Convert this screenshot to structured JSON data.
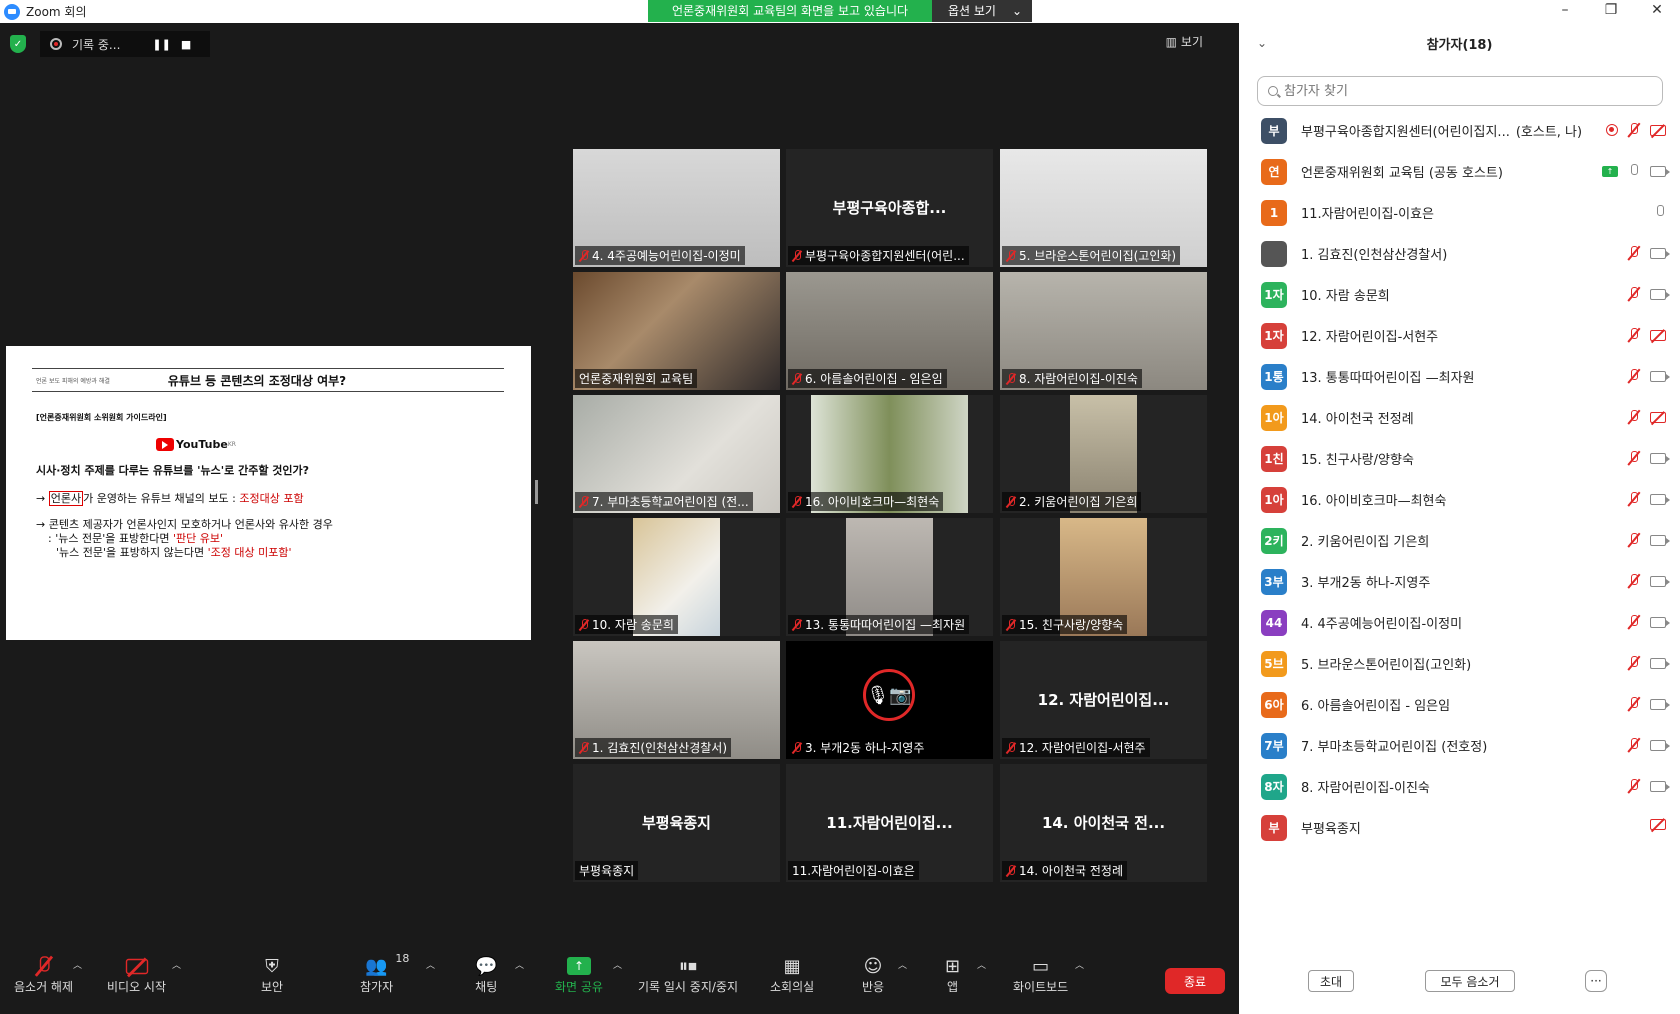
{
  "window": {
    "title": "Zoom 회의",
    "controls": [
      "–",
      "❐",
      "✕"
    ]
  },
  "share_banner": {
    "message": "언론중재위원회 교육팀의 화면을 보고 있습니다",
    "options": "옵션 보기"
  },
  "recording": {
    "status": "기록 중...",
    "pause": "❚❚",
    "stop": "■"
  },
  "view_button": "보기",
  "slide": {
    "header_small": "언론 보도 피해의 예방과 해결",
    "title": "유튜브 등 콘텐츠의 조정대상 여부?",
    "guideline": "[언론중재위원회 소위원회 가이드라인]",
    "youtube_word": "YouTube",
    "youtube_sup": "KR",
    "question": "시사·정치 주제를 다루는 유튜브를 '뉴스'로 간주할 것인가?",
    "line1_arrow": "→ ",
    "line1_boxed": "언론사",
    "line1_rest": "가 운영하는 유튜브 채널의 보도 : ",
    "line1_red": "조정대상 포함",
    "line2_main": "→ 콘텐츠 제공자가 언론사인지 모호하거나 언론사와 유사한 경우",
    "line2_sub1": ": '뉴스 전문'을 표방한다면 ",
    "line2_sub1_red": "'판단 유보'",
    "line2_sub2": "'뉴스 전문'을 표방하지 않는다면 ",
    "line2_sub2_red": "'조정 대상 미포함'"
  },
  "tiles": [
    {
      "label": "4. 4주공예능어린이집-이정미",
      "center": "",
      "muted": true
    },
    {
      "label": "부평구육아종합지원센터(어린...",
      "center": "부평구육아종합...",
      "muted": true
    },
    {
      "label": "5. 브라운스톤어린이집(고인화)",
      "center": "",
      "muted": true
    },
    {
      "label": "언론중재위원회 교육팀",
      "center": "",
      "muted": false
    },
    {
      "label": "6. 아름솔어린이집 - 임은임",
      "center": "",
      "muted": true
    },
    {
      "label": "8. 자람어린이집-이진숙",
      "center": "",
      "muted": true
    },
    {
      "label": "7. 부마초등학교어린이집 (전...",
      "center": "",
      "muted": true
    },
    {
      "label": "16. 아이비호크마—최현숙",
      "center": "",
      "muted": true
    },
    {
      "label": "2. 키움어린이집 기은희",
      "center": "",
      "muted": true
    },
    {
      "label": "10. 자람 송문희",
      "center": "",
      "muted": true
    },
    {
      "label": "13. 통통따따어린이집 —최자원",
      "center": "",
      "muted": true
    },
    {
      "label": "15. 친구사랑/양향숙",
      "center": "",
      "muted": true
    },
    {
      "label": "1. 김효진(인천삼산경찰서)",
      "center": "",
      "muted": true
    },
    {
      "label": "3. 부개2동 하나-지영주",
      "center": "",
      "muted": true
    },
    {
      "label": "12. 자람어린이집-서현주",
      "center": "12. 자람어린이집...",
      "muted": true
    },
    {
      "label": "부평육종지",
      "center": "부평육종지",
      "muted": false
    },
    {
      "label": "11.자람어린이집-이효은",
      "center": "11.자람어린이집...",
      "muted": false
    },
    {
      "label": "14. 아이천국 전정례",
      "center": "14. 아이천국 전...",
      "muted": true
    }
  ],
  "toolbar": {
    "unmute": "음소거 해제",
    "start_video": "비디오 시작",
    "security": "보안",
    "participants": "참가자",
    "participants_count": "18",
    "chat": "채팅",
    "share_screen": "화면 공유",
    "pause_record": "기록 일시 중지/중지",
    "breakout": "소회의실",
    "reactions": "반응",
    "apps": "앱",
    "whiteboard": "화이트보드",
    "end": "종료"
  },
  "panel": {
    "title": "참가자(18)",
    "search_placeholder": "참가자 찾기",
    "invite": "초대",
    "mute_all": "모두 음소거",
    "more": "···",
    "participants": [
      {
        "initial": "부",
        "color": "#3d4f66",
        "name": "부평구육아종합지원센터(어린이집지...",
        "role": "(호스트, 나)",
        "icons": "rec-mute-camoff"
      },
      {
        "initial": "연",
        "color": "#e86a1a",
        "name": "언론중재위원회 교육팀 (공동 호스트)",
        "role": "",
        "icons": "share-mic-cam"
      },
      {
        "initial": "1",
        "color": "#e86a1a",
        "name": "11.자람어린이집-이효은",
        "role": "",
        "icons": "mic"
      },
      {
        "initial": "",
        "color": "#555555",
        "name": "1. 김효진(인천삼산경찰서)",
        "role": "",
        "icons": "mute-cam"
      },
      {
        "initial": "1자",
        "color": "#2db35d",
        "name": "10. 자람 송문희",
        "role": "",
        "icons": "mute-cam"
      },
      {
        "initial": "1자",
        "color": "#d6403a",
        "name": "12. 자람어린이집-서현주",
        "role": "",
        "icons": "mute-camoff"
      },
      {
        "initial": "1통",
        "color": "#2a7fc9",
        "name": "13. 통통따따어린이집 —최자원",
        "role": "",
        "icons": "mute-cam"
      },
      {
        "initial": "1아",
        "color": "#f29a1c",
        "name": "14. 아이천국 전정례",
        "role": "",
        "icons": "mute-camoff"
      },
      {
        "initial": "1친",
        "color": "#d6403a",
        "name": "15. 친구사랑/양향숙",
        "role": "",
        "icons": "mute-cam"
      },
      {
        "initial": "1아",
        "color": "#d6403a",
        "name": "16. 아이비호크마—최현숙",
        "role": "",
        "icons": "mute-cam"
      },
      {
        "initial": "2키",
        "color": "#2db35d",
        "name": "2. 키움어린이집 기은희",
        "role": "",
        "icons": "mute-cam"
      },
      {
        "initial": "3부",
        "color": "#2a7fc9",
        "name": "3. 부개2동 하나-지영주",
        "role": "",
        "icons": "mute-cam"
      },
      {
        "initial": "44",
        "color": "#8a3ec0",
        "name": "4. 4주공예능어린이집-이정미",
        "role": "",
        "icons": "mute-cam"
      },
      {
        "initial": "5브",
        "color": "#f29a1c",
        "name": "5. 브라운스톤어린이집(고인화)",
        "role": "",
        "icons": "mute-cam"
      },
      {
        "initial": "6아",
        "color": "#e86a1a",
        "name": "6. 아름솔어린이집 - 임은임",
        "role": "",
        "icons": "mute-cam"
      },
      {
        "initial": "7부",
        "color": "#2a7fc9",
        "name": "7. 부마초등학교어린이집 (전호정)",
        "role": "",
        "icons": "mute-cam"
      },
      {
        "initial": "8자",
        "color": "#1fa68a",
        "name": "8. 자람어린이집-이진숙",
        "role": "",
        "icons": "mute-cam"
      },
      {
        "initial": "부",
        "color": "#d6403a",
        "name": "부평육종지",
        "role": "",
        "icons": "camoff"
      }
    ]
  }
}
